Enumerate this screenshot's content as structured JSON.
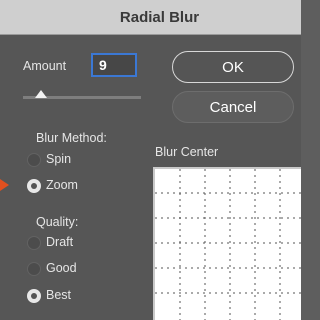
{
  "window": {
    "title": "Radial Blur"
  },
  "amount": {
    "label": "Amount",
    "value": "9",
    "slider_fraction": 0.1
  },
  "buttons": {
    "ok": "OK",
    "cancel": "Cancel"
  },
  "blur_method": {
    "label": "Blur Method:",
    "options": [
      {
        "label": "Spin",
        "selected": false
      },
      {
        "label": "Zoom",
        "selected": true
      }
    ]
  },
  "quality": {
    "label": "Quality:",
    "options": [
      {
        "label": "Draft",
        "selected": false
      },
      {
        "label": "Good",
        "selected": false
      },
      {
        "label": "Best",
        "selected": true
      }
    ]
  },
  "blur_center": {
    "label": "Blur Center"
  },
  "colors": {
    "accent": "#3b78d4",
    "pointer_arrow": "#e2501f"
  }
}
